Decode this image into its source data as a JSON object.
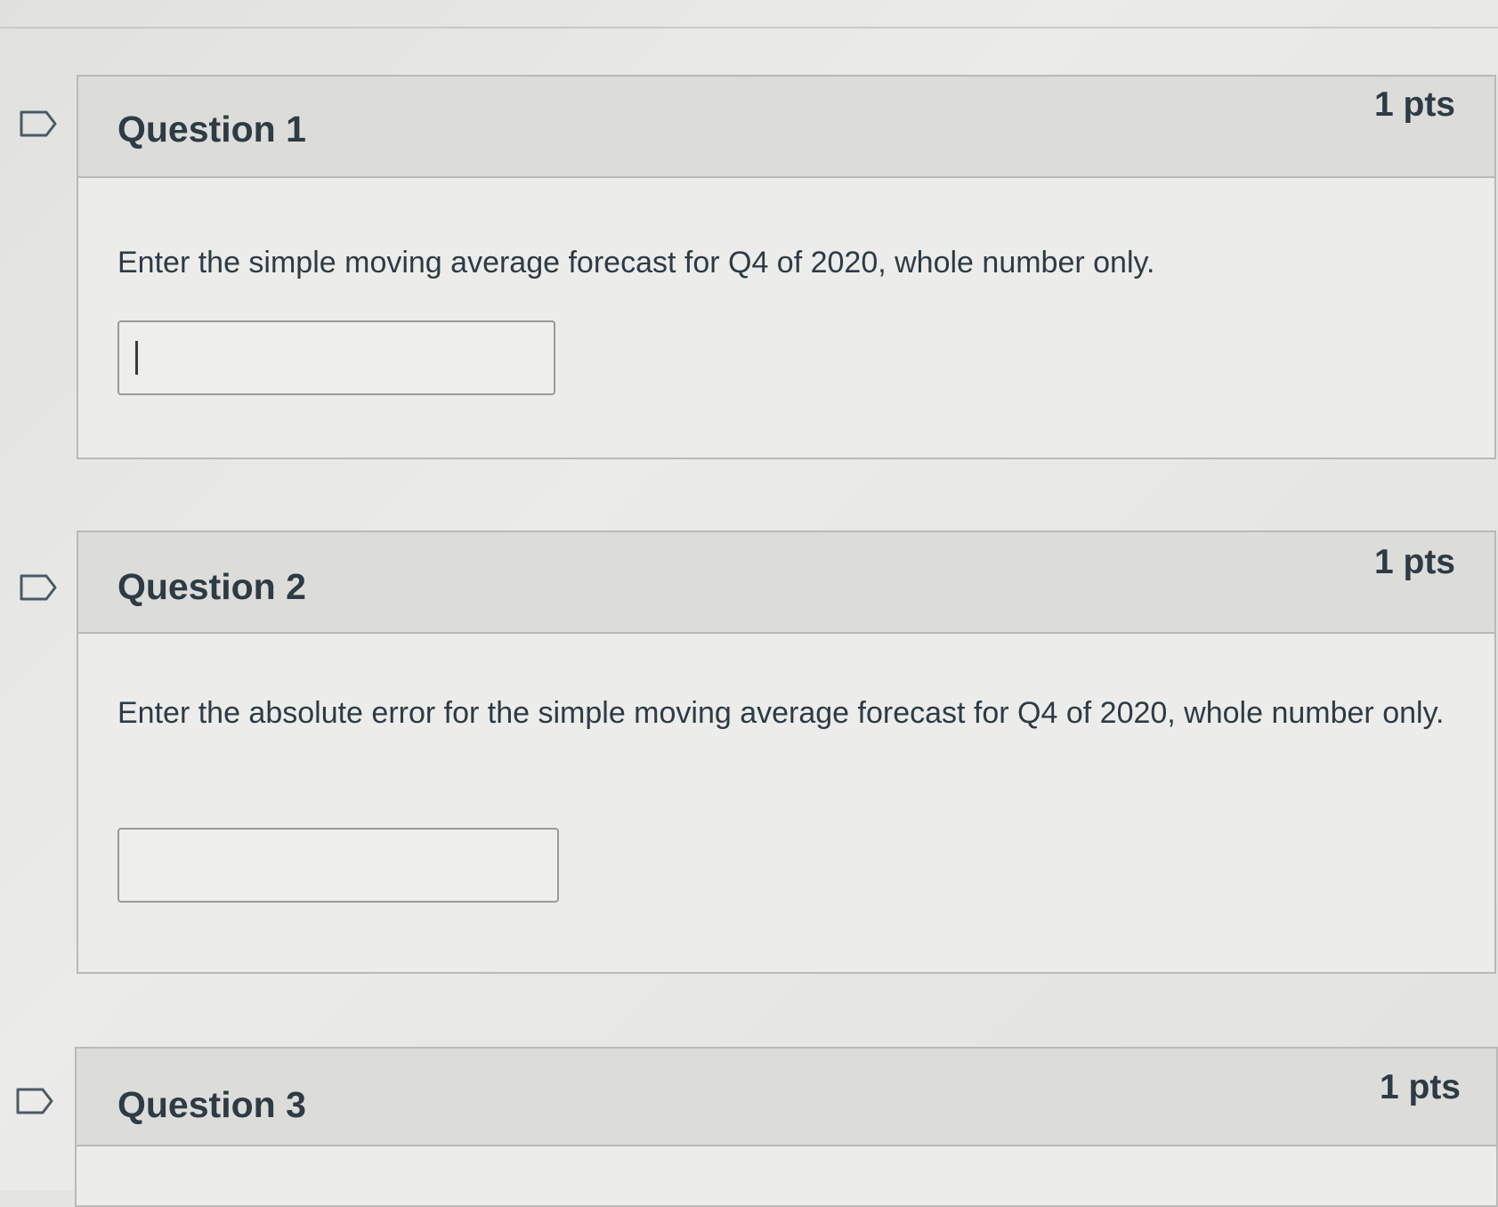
{
  "questions": [
    {
      "title": "Question 1",
      "points": "1 pts",
      "text": "Enter the simple moving average forecast for Q4 of 2020, whole number only.",
      "answer_value": ""
    },
    {
      "title": "Question 2",
      "points": "1 pts",
      "text": "Enter the absolute error for the simple moving average forecast for Q4 of 2020, whole number only.",
      "answer_value": ""
    },
    {
      "title": "Question 3",
      "points": "1 pts"
    }
  ],
  "icons": {
    "flag": "flag-question-icon"
  },
  "colors": {
    "text": "#2d3b45",
    "header_bg": "#dcdcd9",
    "border": "#b9b9b6"
  }
}
